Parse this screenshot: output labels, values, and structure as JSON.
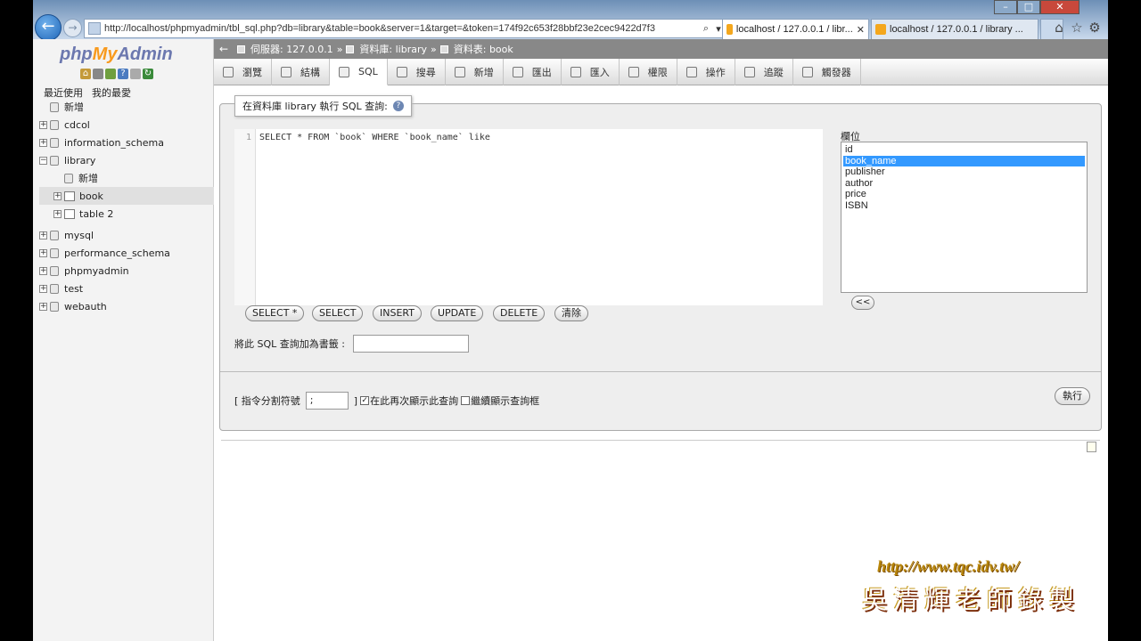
{
  "browser": {
    "url": "http://localhost/phpmyadmin/tbl_sql.php?db=library&table=book&server=1&target=&token=174f92c653f28bbf23e2cec9422d7f3",
    "tabs": [
      {
        "label": "localhost / 127.0.0.1 / libr..."
      },
      {
        "label": "localhost / 127.0.0.1 / library ..."
      }
    ],
    "new_tab": "",
    "address_controls": {
      "search": "⌕",
      "dropdown": "▾",
      "refresh": "↻",
      "stop": "✕"
    }
  },
  "sidebar": {
    "logo_php": "php",
    "logo_my": "My",
    "logo_admin": "Admin",
    "tabs": [
      "最近使用",
      "我的最愛"
    ],
    "tree": [
      {
        "label": "新增",
        "type": "new",
        "indent": 0
      },
      {
        "label": "cdcol",
        "type": "db",
        "indent": 0
      },
      {
        "label": "information_schema",
        "type": "db",
        "indent": 0
      },
      {
        "label": "library",
        "type": "db-open",
        "indent": 0
      },
      {
        "label": "新增",
        "type": "new",
        "indent": 1
      },
      {
        "label": "book",
        "type": "table",
        "indent": 1,
        "selected": true
      },
      {
        "label": "table 2",
        "type": "table",
        "indent": 1
      },
      {
        "label": "mysql",
        "type": "db",
        "indent": 0
      },
      {
        "label": "performance_schema",
        "type": "db",
        "indent": 0
      },
      {
        "label": "phpmyadmin",
        "type": "db",
        "indent": 0
      },
      {
        "label": "test",
        "type": "db",
        "indent": 0
      },
      {
        "label": "webauth",
        "type": "db",
        "indent": 0
      }
    ]
  },
  "breadcrumb": {
    "server": "伺服器: 127.0.0.1",
    "database": "資料庫: library",
    "table": "資料表: book",
    "sep": "»"
  },
  "menu": [
    {
      "label": "瀏覽",
      "icon": "browse-icon"
    },
    {
      "label": "結構",
      "icon": "structure-icon"
    },
    {
      "label": "SQL",
      "icon": "sql-icon",
      "active": true
    },
    {
      "label": "搜尋",
      "icon": "search-icon"
    },
    {
      "label": "新增",
      "icon": "insert-icon"
    },
    {
      "label": "匯出",
      "icon": "export-icon"
    },
    {
      "label": "匯入",
      "icon": "import-icon"
    },
    {
      "label": "權限",
      "icon": "privileges-icon"
    },
    {
      "label": "操作",
      "icon": "operations-icon"
    },
    {
      "label": "追蹤",
      "icon": "tracking-icon"
    },
    {
      "label": "觸發器",
      "icon": "triggers-icon"
    }
  ],
  "sql_panel": {
    "legend": "在資料庫 library 執行 SQL 查詢:",
    "line_number": "1",
    "query": "SELECT * FROM `book` WHERE `book_name` like ",
    "buttons": [
      "SELECT *",
      "SELECT",
      "INSERT",
      "UPDATE",
      "DELETE",
      "清除"
    ],
    "columns_label": "欄位",
    "columns": [
      "id",
      "book_name",
      "publisher",
      "author",
      "price",
      "ISBN"
    ],
    "selected_column": "book_name",
    "insert_column_button": "<<",
    "bookmark_label": "將此 SQL 查詢加為書籤 :",
    "bookmark_value": "",
    "delimiter_label": "[ 指令分割符號",
    "delimiter_value": ";",
    "delimiter_close": "]",
    "show_query_again_label": "在此再次顯示此查詢",
    "show_query_again_checked": true,
    "retain_box_label": "繼續顯示查詢框",
    "retain_box_checked": false,
    "go_button": "執行"
  },
  "watermark": {
    "url": "http://www.tqc.idv.tw/",
    "name": "吳清輝老師錄製"
  }
}
